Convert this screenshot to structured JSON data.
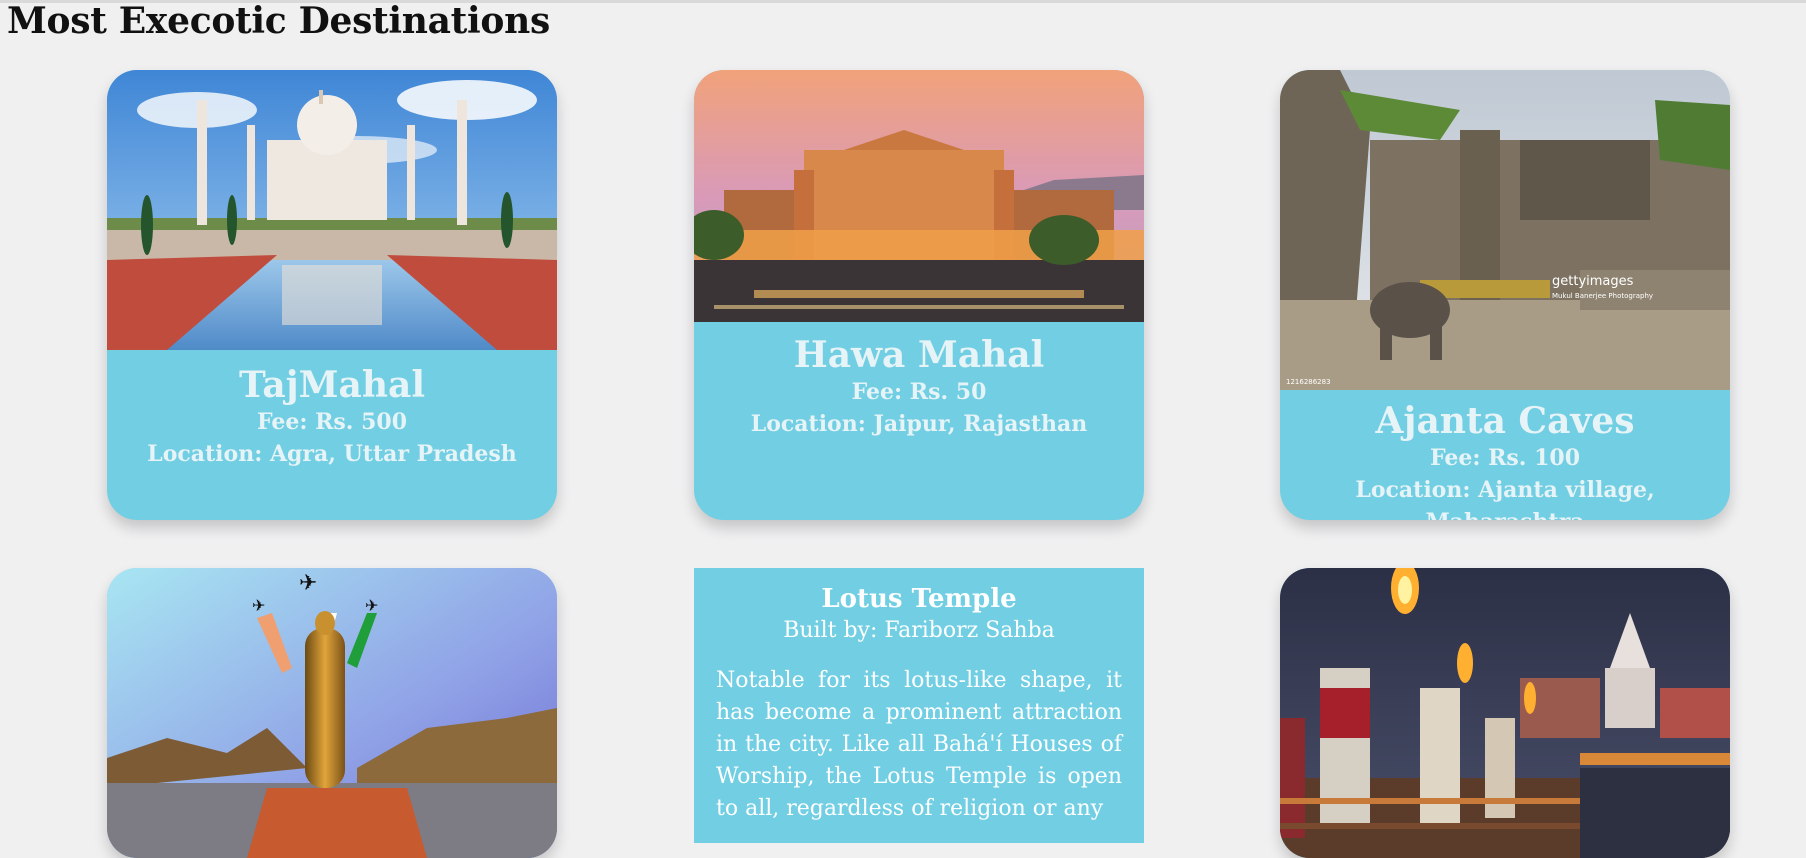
{
  "page": {
    "heading": "Most Execotic Destinations"
  },
  "cards": [
    {
      "title": "TajMahal",
      "fee": "Fee: Rs. 500",
      "location": "Location: Agra, Uttar Pradesh",
      "image": "taj-mahal-photo"
    },
    {
      "title": "Hawa Mahal",
      "fee": "Fee: Rs. 50",
      "location": "Location: Jaipur, Rajasthan",
      "image": "hawa-mahal-photo"
    },
    {
      "title": "Ajanta Caves",
      "fee": "Fee: Rs. 100",
      "location": "Location: Ajanta village, Maharashtra",
      "image": "ajanta-caves-photo",
      "watermark": {
        "brand": "gettyimages",
        "credit": "Mukul Banerjee Photography",
        "id": "1216286283"
      }
    },
    {
      "image": "statue-of-unity-photo"
    },
    {
      "title": "Lotus Temple",
      "built_by": "Built by: Fariborz Sahba",
      "description": "Notable for its lotus-like shape, it has become a prominent attraction in the city. Like all Bahá'í Houses of Worship, the Lotus Temple is open to all, regardless of religion or any"
    },
    {
      "image": "ganga-aarti-photo"
    }
  ],
  "colors": {
    "card": "#72cfe3",
    "background": "#f0f0f1"
  }
}
